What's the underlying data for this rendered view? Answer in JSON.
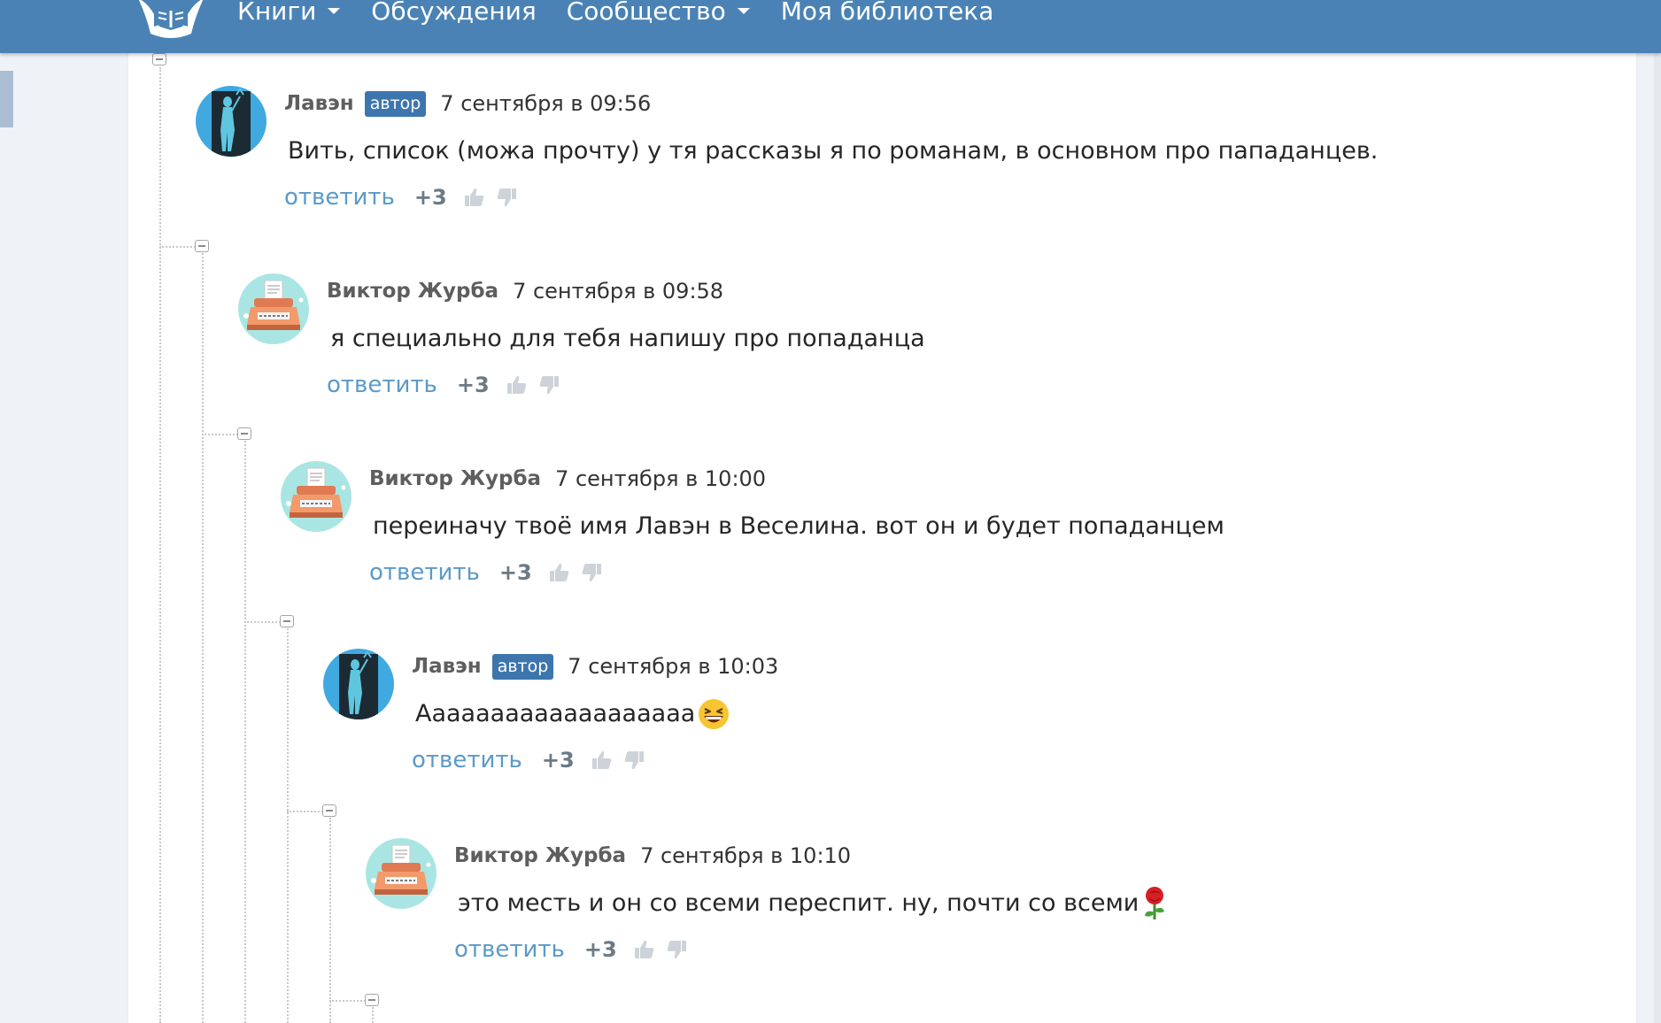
{
  "nav": {
    "items": [
      {
        "label": "Книги",
        "has_dropdown": true
      },
      {
        "label": "Обсуждения",
        "has_dropdown": false
      },
      {
        "label": "Сообщество",
        "has_dropdown": true
      },
      {
        "label": "Моя библиотека",
        "has_dropdown": false
      }
    ]
  },
  "comments": [
    {
      "author": "Лавэн",
      "badge": "автор",
      "date": "7 сентября в 09:56",
      "text": "Вить, список (можа прочту) у тя рассказы я по романам, в основном про пападанцев.",
      "reply_label": "ответить",
      "score": "+3",
      "avatar": "lavan-avatar",
      "emoji": ""
    },
    {
      "author": "Виктор Журба",
      "badge": "",
      "date": "7 сентября в 09:58",
      "text": "я специально для тебя напишу про попаданца",
      "reply_label": "ответить",
      "score": "+3",
      "avatar": "typewriter-avatar",
      "emoji": ""
    },
    {
      "author": "Виктор Журба",
      "badge": "",
      "date": "7 сентября в 10:00",
      "text": "переиначу твоё имя Лавэн в Веселина. вот он и будет попаданцем",
      "reply_label": "ответить",
      "score": "+3",
      "avatar": "typewriter-avatar",
      "emoji": ""
    },
    {
      "author": "Лавэн",
      "badge": "автор",
      "date": "7 сентября в 10:03",
      "text": "Ааааааааааааааааааа",
      "reply_label": "ответить",
      "score": "+3",
      "avatar": "lavan-avatar",
      "emoji": "laughing-face-emoji"
    },
    {
      "author": "Виктор Журба",
      "badge": "",
      "date": "7 сентября в 10:10",
      "text": "это месть и он со всеми переспит. ну, почти со всеми",
      "reply_label": "ответить",
      "score": "+3",
      "avatar": "typewriter-avatar",
      "emoji": "rose-emoji"
    }
  ],
  "colors": {
    "header": "#4a82b5",
    "badge": "#3d76ad",
    "reply_link": "#5b9ac9",
    "avatar_bg_lavan": "#3fa9e0",
    "avatar_bg_typewriter": "#a9e6e3"
  }
}
